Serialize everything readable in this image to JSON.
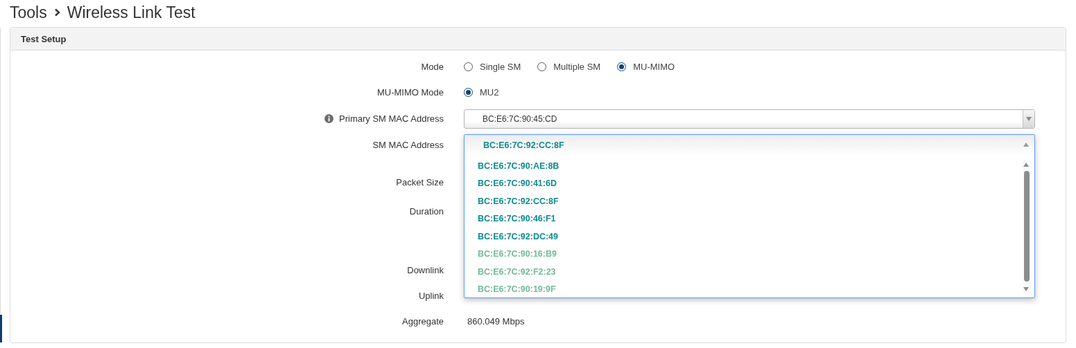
{
  "breadcrumb": [
    "Tools",
    "Wireless Link Test"
  ],
  "panel": {
    "title": "Test Setup",
    "rows": [
      {
        "kind": "radio",
        "label": "Mode",
        "options": [
          {
            "label": "Single SM",
            "selected": false
          },
          {
            "label": "Multiple SM",
            "selected": false
          },
          {
            "label": "MU-MIMO",
            "selected": true
          }
        ]
      },
      {
        "kind": "radio",
        "label": "MU-MIMO Mode",
        "options": [
          {
            "label": "MU2",
            "selected": true
          }
        ]
      },
      {
        "kind": "select",
        "label": "Primary SM MAC Address",
        "info": true,
        "value": "BC:E6:7C:90:45:CD"
      },
      {
        "kind": "open-select",
        "label": "SM MAC Address",
        "value": "BC:E6:7C:92:CC:8F",
        "options": [
          {
            "label": "BC:E6:7C:90:AE:8B",
            "color": "#0e8a8f"
          },
          {
            "label": "BC:E6:7C:90:41:6D",
            "color": "#0e8a8f"
          },
          {
            "label": "BC:E6:7C:92:CC:8F",
            "color": "#0e8a8f"
          },
          {
            "label": "BC:E6:7C:90:46:F1",
            "color": "#0e8a8f"
          },
          {
            "label": "BC:E6:7C:92:DC:49",
            "color": "#0e8a8f"
          },
          {
            "label": "BC:E6:7C:90:16:B9",
            "color": "#72bb98"
          },
          {
            "label": "BC:E6:7C:92:F2:23",
            "color": "#72bb98"
          },
          {
            "label": "BC:E6:7C:90:19:9F",
            "color": "#72bb98"
          }
        ]
      },
      {
        "kind": "blank",
        "label": "Packet Size"
      },
      {
        "kind": "blank",
        "label": "Duration"
      },
      {
        "kind": "blank",
        "label": "Downlink"
      },
      {
        "kind": "blank",
        "label": "Uplink"
      },
      {
        "kind": "text",
        "label": "Aggregate",
        "value": "860.049 Mbps"
      }
    ]
  }
}
